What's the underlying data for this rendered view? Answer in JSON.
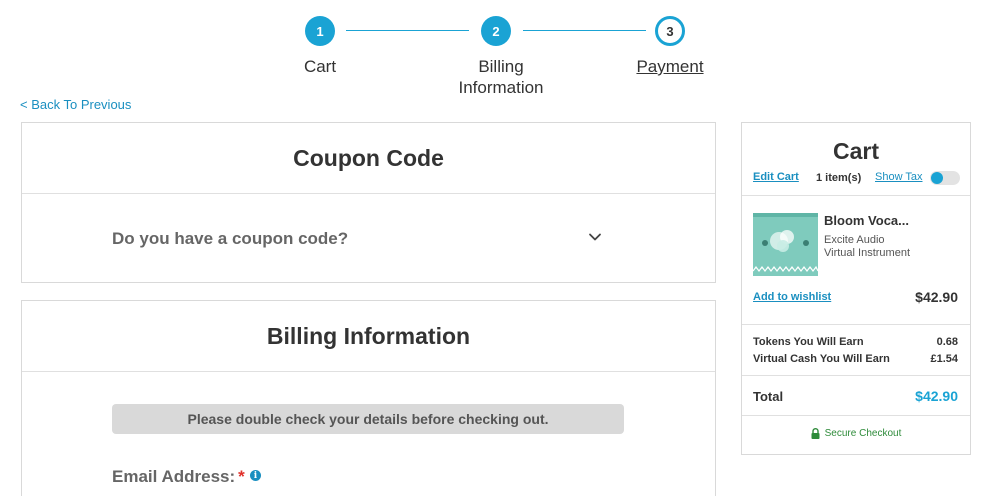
{
  "stepper": {
    "steps": [
      {
        "number": "1",
        "label_line1": "Cart",
        "label_line2": "",
        "state": "complete"
      },
      {
        "number": "2",
        "label_line1": "Billing",
        "label_line2": "Information",
        "state": "complete"
      },
      {
        "number": "3",
        "label_line1": "Payment",
        "label_line2": "",
        "state": "current"
      }
    ]
  },
  "nav": {
    "back_label": "< Back To Previous"
  },
  "coupon": {
    "title": "Coupon Code",
    "question": "Do you have a coupon code?",
    "chevron_icon": "chevron-down-icon"
  },
  "billing": {
    "title": "Billing Information",
    "notice": "Please double check your details before checking out.",
    "email_label": "Email Address:",
    "required_mark": "*",
    "info_icon": "i"
  },
  "cart": {
    "title": "Cart",
    "edit_label": "Edit Cart",
    "item_count": "1 item(s)",
    "show_tax_label": "Show Tax",
    "show_tax_on": false,
    "item": {
      "name": "Bloom Voca...",
      "brand": "Excite Audio",
      "type": "Virtual Instrument",
      "wishlist_label": "Add to wishlist",
      "price": "$42.90"
    },
    "tokens_label": "Tokens You Will Earn",
    "tokens_value": "0.68",
    "cash_label": "Virtual Cash You Will Earn",
    "cash_value": "£1.54",
    "total_label": "Total",
    "total_value": "$42.90",
    "secure_label": "Secure Checkout",
    "secure_icon": "lock-icon"
  },
  "colors": {
    "accent": "#1aa3d4",
    "link": "#1a8fc0",
    "total": "#1aa3d4",
    "secure": "#2e8b3a",
    "required": "#e0302a"
  }
}
